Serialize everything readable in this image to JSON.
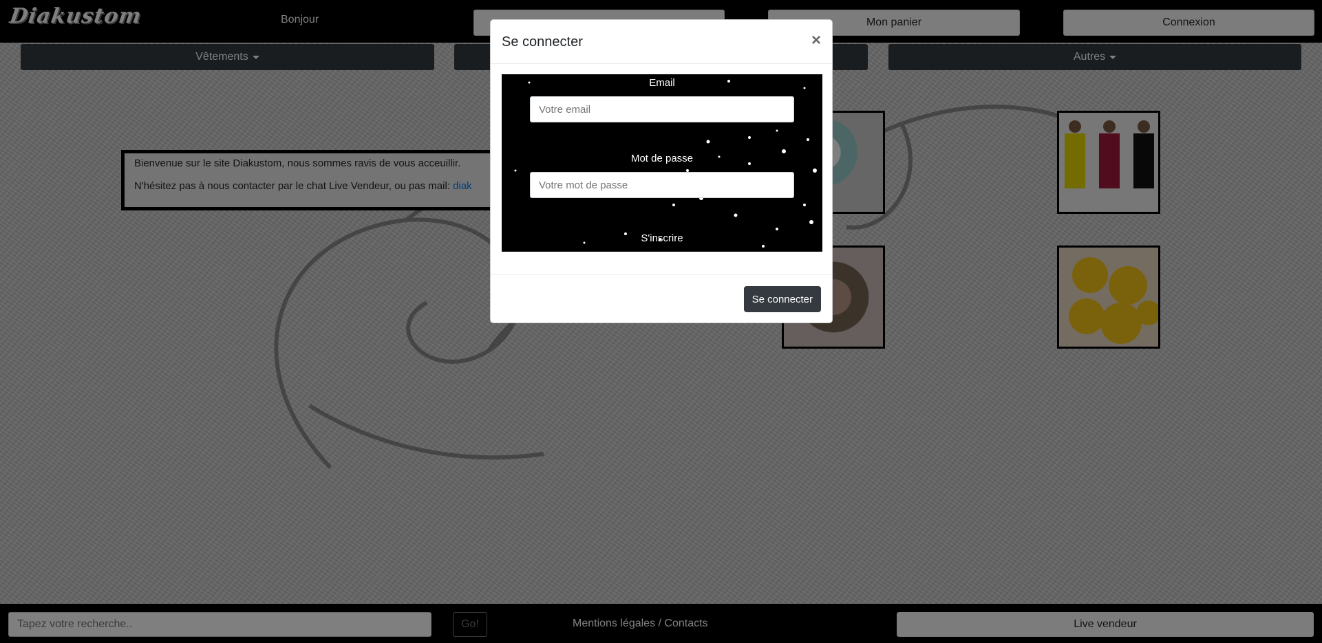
{
  "header": {
    "logo_text": "Diakustom",
    "greeting": "Bonjour",
    "hidden_button_label": "",
    "cart_label": "Mon panier",
    "login_label": "Connexion"
  },
  "categories": [
    {
      "label": "Vêtements"
    },
    {
      "label": ""
    },
    {
      "label": "Autres"
    }
  ],
  "welcome": {
    "line1": "Bienvenue sur le site Diakustom, nous sommes ravis de vous acceuillir.",
    "line2_prefix": "N'hésitez pas à nous contacter par le chat Live Vendeur, ou pas mail: ",
    "line2_link": "diak"
  },
  "products": [
    {
      "name": "badges"
    },
    {
      "name": "dresses"
    },
    {
      "name": "badges"
    },
    {
      "name": "emojis"
    }
  ],
  "footer": {
    "search_placeholder": "Tapez votre recherche..",
    "go_label": "Go!",
    "mentions_label": "Mentions légales / Contacts",
    "live_label": "Live vendeur"
  },
  "modal": {
    "title": "Se connecter",
    "close_glyph": "×",
    "email_label": "Email",
    "email_placeholder": "Votre email",
    "password_label": "Mot de passe",
    "password_placeholder": "Votre mot de passe",
    "signup_label": "S'inscrire",
    "submit_label": "Se connecter"
  },
  "colors": {
    "dark_button": "#343a40",
    "light_button": "#f8f9fa",
    "link": "#007bff",
    "bar": "#000000"
  }
}
